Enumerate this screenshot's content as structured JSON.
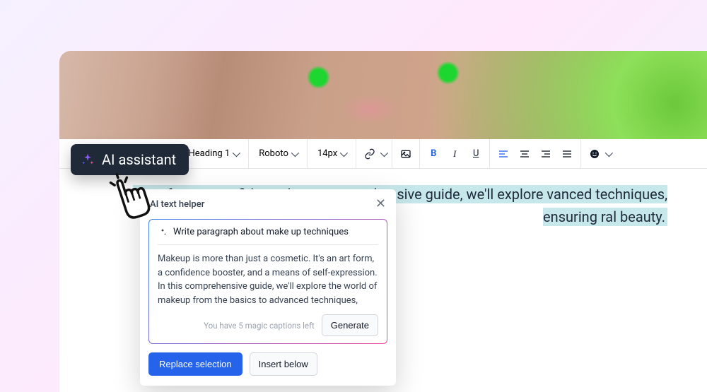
{
  "ai_badge": {
    "label": "AI assistant"
  },
  "toolbar": {
    "heading": "Heading 1",
    "font": "Roboto",
    "size": "14px",
    "bold": "B",
    "italic": "I",
    "underline": "U"
  },
  "content": {
    "paragraph": "n art form, a confidence booster, mprehensive guide, we'll explore vanced techniques, ensuring ral beauty."
  },
  "popup": {
    "title": "AI text helper",
    "prompt": "Write paragraph about make up techniques",
    "generated": "Makeup is more than just a cosmetic. It's an art form, a confidence booster, and a means of self-expression. In this comprehensive guide, we'll explore the world of makeup from the basics to advanced techniques,",
    "captions_hint": "You have 5 magic captions left",
    "generate_label": "Generate",
    "replace_label": "Replace selection",
    "insert_label": "Insert below"
  }
}
